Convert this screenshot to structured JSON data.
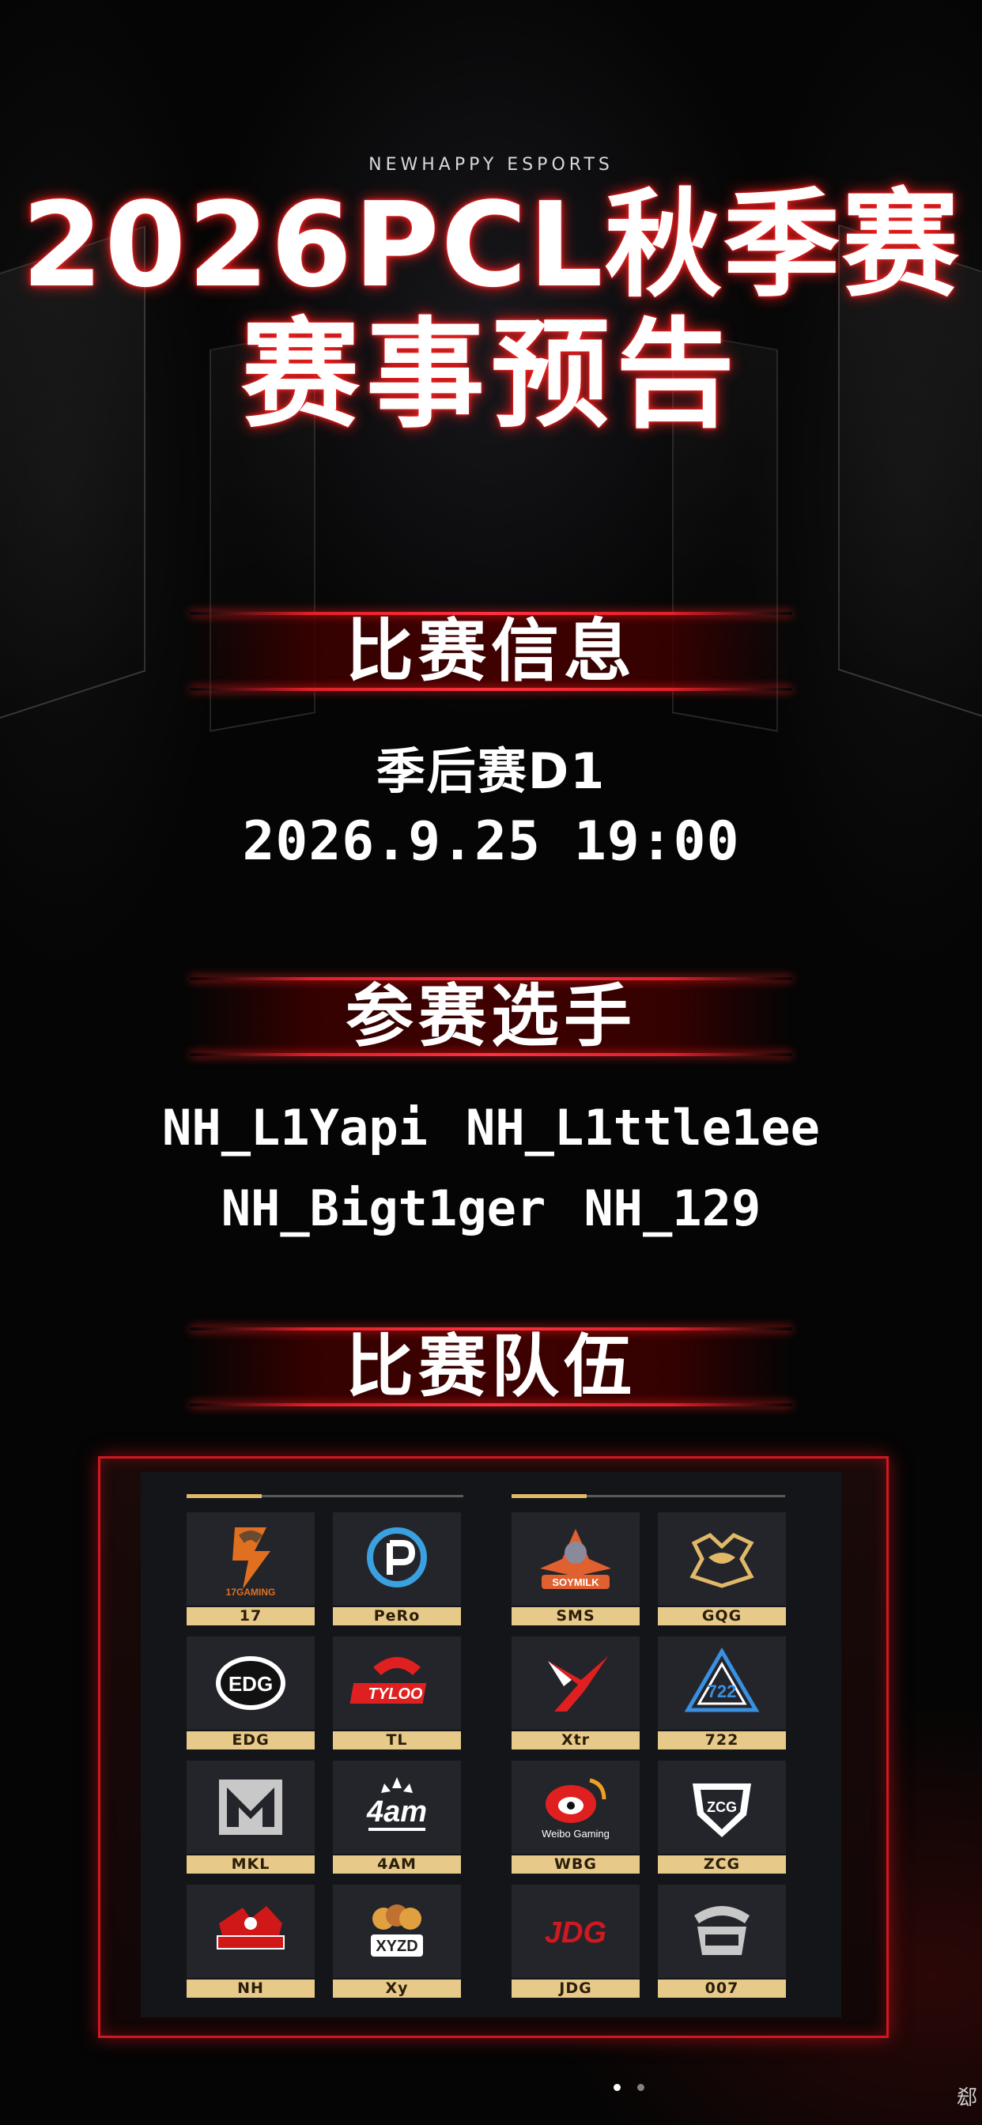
{
  "brand": "NEWHAPPY ESPORTS",
  "title_line1": "2026PCL秋季赛",
  "title_line2": "赛事预告",
  "sections": {
    "match_info": "比赛信息",
    "players": "参赛选手",
    "teams": "比赛队伍"
  },
  "match": {
    "stage": "季后赛D1",
    "datetime": "2026.9.25 19:00"
  },
  "players": [
    "NH_L1Yapi",
    "NH_L1ttle1ee",
    "NH_Bigt1ger",
    "NH_129"
  ],
  "teams": [
    {
      "name": "17",
      "icon": "team-17-logo",
      "color": "#e07020"
    },
    {
      "name": "PeRo",
      "icon": "team-pero-logo",
      "color": "#3aa0e0"
    },
    {
      "name": "SMS",
      "icon": "team-sms-logo",
      "color": "#e06030"
    },
    {
      "name": "GQG",
      "icon": "team-gqg-logo",
      "color": "#e0b868"
    },
    {
      "name": "EDG",
      "icon": "team-edg-logo",
      "color": "#ffffff"
    },
    {
      "name": "TL",
      "icon": "team-tl-logo",
      "color": "#e02020"
    },
    {
      "name": "Xtr",
      "icon": "team-xtr-logo",
      "color": "#e02020"
    },
    {
      "name": "722",
      "icon": "team-722-logo",
      "color": "#3a90e0"
    },
    {
      "name": "MKL",
      "icon": "team-mkl-logo",
      "color": "#c8c8c8"
    },
    {
      "name": "4AM",
      "icon": "team-4am-logo",
      "color": "#ffffff"
    },
    {
      "name": "WBG",
      "icon": "team-wbg-logo",
      "color": "#e02020"
    },
    {
      "name": "ZCG",
      "icon": "team-zcg-logo",
      "color": "#ffffff"
    },
    {
      "name": "NH",
      "icon": "team-nh-logo",
      "color": "#d01818"
    },
    {
      "name": "Xy",
      "icon": "team-xy-logo",
      "color": "#e0a040"
    },
    {
      "name": "JDG",
      "icon": "team-jdg-logo",
      "color": "#d01820"
    },
    {
      "name": "007",
      "icon": "team-007-logo",
      "color": "#c8c8c8"
    }
  ],
  "logo_texts": {
    "t17": "17GAMING",
    "edg": "EDG",
    "tl": "TYLOO",
    "wbg": "Weibo Gaming",
    "am": "4am",
    "zcg": "ZCG",
    "xyzd": "XYZD",
    "jdg": "JDG",
    "sms": "SOYMILK"
  },
  "watermark": "郄"
}
